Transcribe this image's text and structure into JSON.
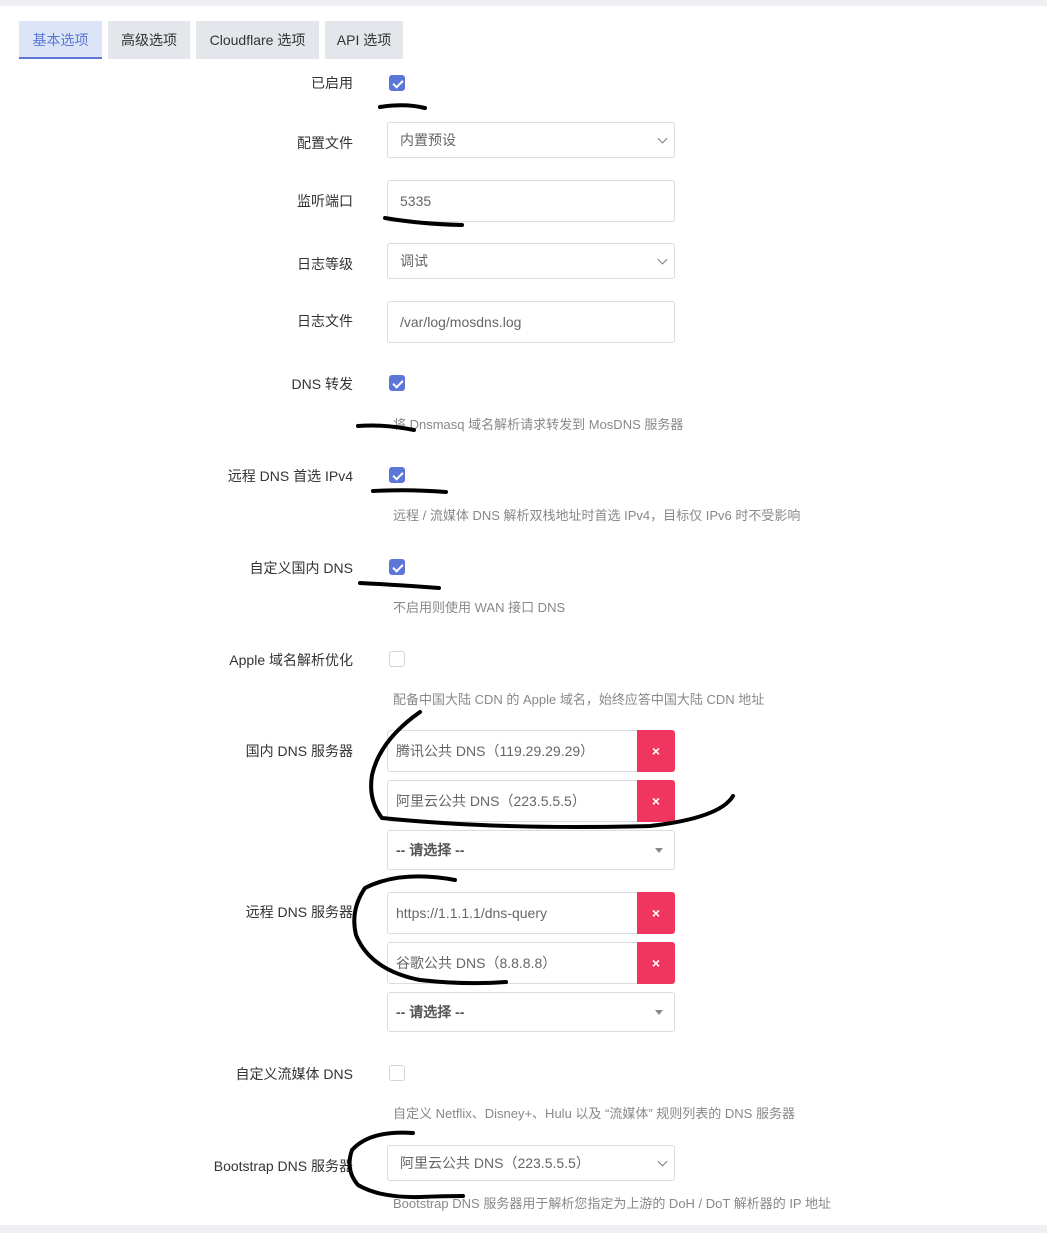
{
  "tabs": [
    "基本选项",
    "高级选项",
    "Cloudflare 选项",
    "API 选项"
  ],
  "form": {
    "enabled": {
      "label": "已启用",
      "checked": true
    },
    "config_file": {
      "label": "配置文件",
      "value": "内置预设"
    },
    "listen_port": {
      "label": "监听端口",
      "value": "5335"
    },
    "log_level": {
      "label": "日志等级",
      "value": "调试"
    },
    "log_file": {
      "label": "日志文件",
      "value": "/var/log/mosdns.log"
    },
    "dns_forward": {
      "label": "DNS 转发",
      "checked": true,
      "desc": "将 Dnsmasq 域名解析请求转发到 MosDNS 服务器"
    },
    "prefer_ipv4": {
      "label": "远程 DNS 首选 IPv4",
      "checked": true,
      "desc": "远程 / 流媒体 DNS 解析双栈地址时首选 IPv4，目标仅 IPv6 时不受影响"
    },
    "custom_local_dns": {
      "label": "自定义国内 DNS",
      "checked": true,
      "desc": "不启用则使用 WAN 接口 DNS"
    },
    "apple_opt": {
      "label": "Apple 域名解析优化",
      "checked": false,
      "desc": "配备中国大陆 CDN 的 Apple 域名，始终应答中国大陆 CDN 地址"
    },
    "local_dns": {
      "label": "国内 DNS 服务器",
      "items": [
        "腾讯公共 DNS（119.29.29.29）",
        "阿里云公共 DNS（223.5.5.5）"
      ],
      "placeholder": "-- 请选择 --"
    },
    "remote_dns": {
      "label": "远程 DNS 服务器",
      "items": [
        "https://1.1.1.1/dns-query",
        "谷歌公共 DNS（8.8.8.8）"
      ],
      "placeholder": "-- 请选择 --"
    },
    "stream_dns": {
      "label": "自定义流媒体 DNS",
      "checked": false,
      "desc": "自定义 Netflix、Disney+、Hulu 以及 “流媒体” 规则列表的 DNS 服务器"
    },
    "bootstrap_dns": {
      "label": "Bootstrap DNS 服务器",
      "value": "阿里云公共 DNS（223.5.5.5）",
      "desc": "Bootstrap DNS 服务器用于解析您指定为上游的 DoH / DoT 解析器的 IP 地址"
    },
    "remove_symbol": "×"
  },
  "colors": {
    "accent": "#5b76d6",
    "danger": "#f0365f"
  }
}
